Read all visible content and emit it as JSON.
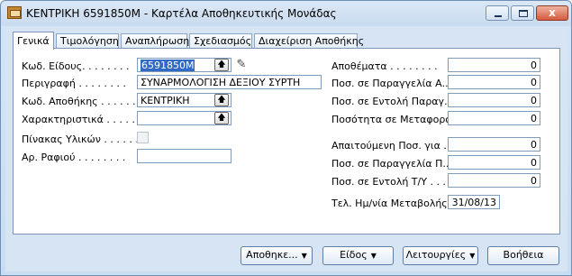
{
  "window": {
    "title": "ΚΕΝΤΡΙΚΗ 6591850M - Καρτέλα Αποθηκευτικής Μονάδας",
    "icon": "app-icon",
    "close_glyph": "x"
  },
  "tabs": [
    {
      "label": "Γενικά",
      "active": true
    },
    {
      "label": "Τιμολόγηση",
      "active": false
    },
    {
      "label": "Αναπλήρωση",
      "active": false
    },
    {
      "label": "Σχεδιασμός",
      "active": false
    },
    {
      "label": "Διαχείριση Αποθήκης",
      "active": false
    }
  ],
  "left": {
    "item_no": {
      "label": "Κωδ. Είδους. . . . . . . .",
      "value": "6591850M"
    },
    "description": {
      "label": "Περιγραφή . . . . . . . .",
      "value": "ΣΥΝΑΡΜΟΛΟΓΙΣΗ ΔΕΞΙΟΥ ΣΥΡΤΗ"
    },
    "location": {
      "label": "Κωδ. Αποθήκης . . . . . .",
      "value": "ΚΕΝΤΡΙΚΗ"
    },
    "variant": {
      "label": "Χαρακτηριστικά . . . . . .",
      "value": ""
    },
    "bom": {
      "label": "Πίνακας Υλικών . . . . . .",
      "checked": false
    },
    "shelf_no": {
      "label": "Αρ. Ραφιού . . . . . . . .",
      "value": ""
    }
  },
  "right": {
    "inventory": {
      "label": "Αποθέματα . . . . . . . .",
      "value": "0"
    },
    "qty_on_prod_order": {
      "label": "Ποσ. σε Παραγγελία Α...",
      "value": "0"
    },
    "qty_on_order_prod": {
      "label": "Ποσ. σε Εντολή Παραγ...",
      "value": "0"
    },
    "qty_in_transit": {
      "label": "Ποσότητα σε Μεταφορά . .",
      "value": "0"
    },
    "qty_required": {
      "label": "Απαιτούμενη Ποσ. για ...",
      "value": "0"
    },
    "qty_on_order_p": {
      "label": "Ποσ. σε Παραγγελία Π...",
      "value": "0"
    },
    "qty_on_order_ty": {
      "label": "Ποσ. σε Εντολή Τ/Υ . . .",
      "value": "0"
    },
    "last_modified": {
      "label": "Τελ. Ημ/νία Μεταβολής . .",
      "value": "31/08/13"
    }
  },
  "buttons": {
    "location": "Αποθηκε...",
    "item": "Είδος",
    "functions": "Λειτουργίες",
    "help": "Βοήθεια"
  }
}
